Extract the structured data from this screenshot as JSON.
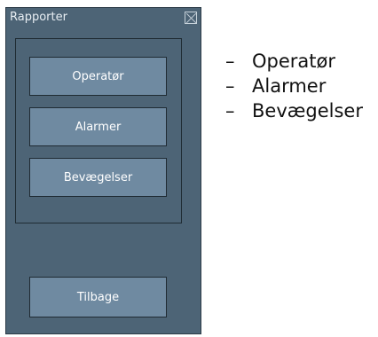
{
  "window": {
    "title": "Rapporter",
    "close_icon": "close-icon"
  },
  "menu": {
    "buttons": [
      {
        "label": "Operatør"
      },
      {
        "label": "Alarmer"
      },
      {
        "label": "Bevægelser"
      }
    ],
    "back_label": "Tilbage"
  },
  "legend": {
    "items": [
      {
        "label": "Operatør"
      },
      {
        "label": "Alarmer"
      },
      {
        "label": "Bevægelser"
      }
    ]
  },
  "colors": {
    "panel_bg": "#4d6476",
    "button_bg": "#6f8aa1",
    "border": "#1f2b33"
  }
}
